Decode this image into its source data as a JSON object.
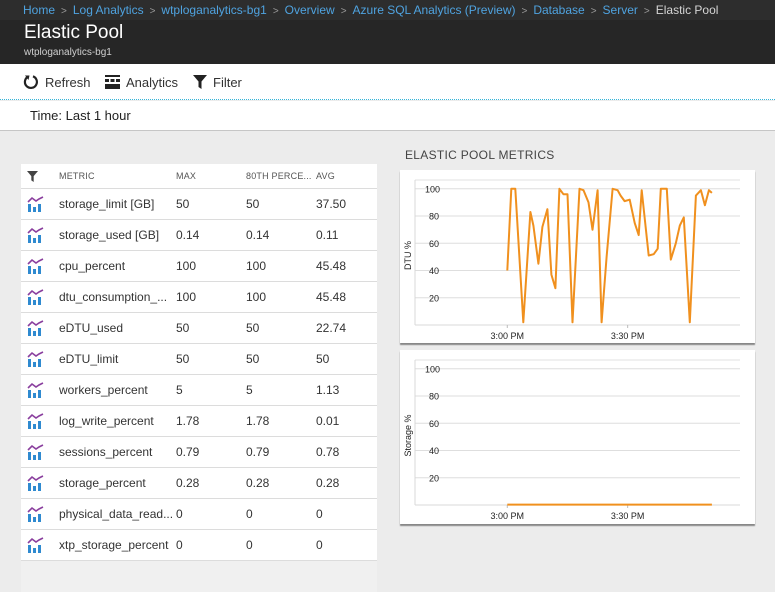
{
  "breadcrumb": {
    "items": [
      "Home",
      "Log Analytics",
      "wtploganalytics-bg1",
      "Overview",
      "Azure SQL Analytics (Preview)",
      "Database",
      "Server"
    ],
    "current": "Elastic Pool"
  },
  "header": {
    "title": "Elastic Pool",
    "subtitle": "wtploganalytics-bg1"
  },
  "toolbar": {
    "refresh_label": "Refresh",
    "analytics_label": "Analytics",
    "filter_label": "Filter"
  },
  "time": {
    "label": "Time: Last 1 hour"
  },
  "table": {
    "columns": [
      "METRIC",
      "MAX",
      "80TH PERCE...",
      "AVG"
    ],
    "rows": [
      {
        "metric": "storage_limit [GB]",
        "max": "50",
        "p80": "50",
        "avg": "37.50"
      },
      {
        "metric": "storage_used [GB]",
        "max": "0.14",
        "p80": "0.14",
        "avg": "0.11"
      },
      {
        "metric": "cpu_percent",
        "max": "100",
        "p80": "100",
        "avg": "45.48"
      },
      {
        "metric": "dtu_consumption_...",
        "max": "100",
        "p80": "100",
        "avg": "45.48"
      },
      {
        "metric": "eDTU_used",
        "max": "50",
        "p80": "50",
        "avg": "22.74"
      },
      {
        "metric": "eDTU_limit",
        "max": "50",
        "p80": "50",
        "avg": "50"
      },
      {
        "metric": "workers_percent",
        "max": "5",
        "p80": "5",
        "avg": "1.13"
      },
      {
        "metric": "log_write_percent",
        "max": "1.78",
        "p80": "1.78",
        "avg": "0.01"
      },
      {
        "metric": "sessions_percent",
        "max": "0.79",
        "p80": "0.79",
        "avg": "0.78"
      },
      {
        "metric": "storage_percent",
        "max": "0.28",
        "p80": "0.28",
        "avg": "0.28"
      },
      {
        "metric": "physical_data_read...",
        "max": "0",
        "p80": "0",
        "avg": "0"
      },
      {
        "metric": "xtp_storage_percent",
        "max": "0",
        "p80": "0",
        "avg": "0"
      }
    ]
  },
  "metrics_section": {
    "title": "ELASTIC POOL METRICS"
  },
  "colors": {
    "series": "#f0901e",
    "link": "#4fa3e0",
    "accent_dotted": "#35b5d9"
  },
  "chart_data": [
    {
      "type": "line",
      "title": "",
      "ylabel": "DTU %",
      "xlabel": "",
      "ylim": [
        0,
        105
      ],
      "yticks": [
        20,
        40,
        60,
        80,
        100
      ],
      "xticks": [
        {
          "label": "3:00 PM",
          "minute": 0
        },
        {
          "label": "3:30 PM",
          "minute": 30
        }
      ],
      "xlim_minutes": [
        -23,
        58
      ],
      "grid": true,
      "series": [
        {
          "name": "DTU %",
          "x_minutes": [
            0,
            1,
            2,
            4,
            5.75,
            6.5,
            7.75,
            8.75,
            10,
            11,
            12,
            13,
            14,
            15,
            16.25,
            18,
            19,
            20.25,
            21.25,
            22.5,
            23.5,
            24.75,
            26.25,
            27.5,
            28.25,
            29.25,
            30.5,
            31.75,
            32.75,
            33.5,
            35.25,
            36.5,
            37.5,
            38.25,
            39.75,
            40.75,
            42,
            43,
            44,
            45.5,
            47,
            48.25,
            49.25,
            50.25,
            51
          ],
          "values": [
            40,
            100,
            100,
            2,
            83,
            73,
            45,
            72,
            85,
            37,
            27,
            100,
            96,
            96,
            2,
            100,
            99,
            90,
            70,
            99,
            2,
            50,
            100,
            99,
            95,
            91,
            92,
            75,
            66,
            99,
            51,
            52,
            56,
            100,
            100,
            48,
            60,
            73,
            79,
            2,
            95,
            99,
            88,
            99,
            97
          ]
        }
      ]
    },
    {
      "type": "line",
      "title": "",
      "ylabel": "Storage %",
      "xlabel": "",
      "ylim": [
        0,
        105
      ],
      "yticks": [
        20,
        40,
        60,
        80,
        100
      ],
      "xticks": [
        {
          "label": "3:00 PM",
          "minute": 0
        },
        {
          "label": "3:30 PM",
          "minute": 30
        }
      ],
      "xlim_minutes": [
        -23,
        58
      ],
      "grid": true,
      "series": [
        {
          "name": "Storage %",
          "x_minutes": [
            0,
            51
          ],
          "values": [
            0.28,
            0.28
          ]
        }
      ]
    }
  ]
}
